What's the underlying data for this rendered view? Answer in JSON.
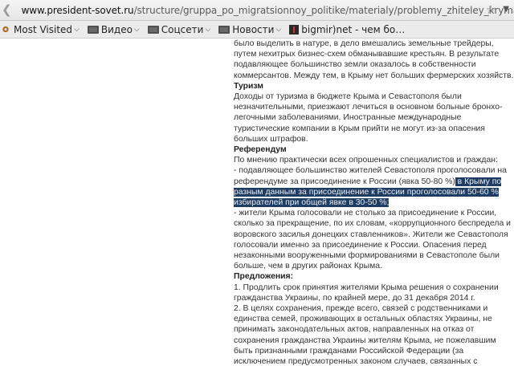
{
  "browser": {
    "url_domain": "www.president-sovet.ru",
    "url_path": "/structure/gruppa_po_migratsionnoy_politike/materialy/problemy_zhiteley_kryma.php",
    "bookmarks": [
      {
        "label": "Most Visited",
        "icon": "gear-icon"
      },
      {
        "label": "Видео",
        "icon": "folder-icon"
      },
      {
        "label": "Соцсети",
        "icon": "folder-icon"
      },
      {
        "label": "Новости",
        "icon": "folder-icon"
      },
      {
        "label": "bigmir)net - чем бо…",
        "icon": "site-icon"
      }
    ]
  },
  "article": {
    "p_land": "было выделить в натуре, в дело вмешались земельные трейдеры, путем нехитрых бизнес-схем обманывавшие крестьян. В результате подавляющее большинство земли оказалось в собственности коммерсантов. Между тем, в Крыму нет больших фермерских хозяйств.",
    "h_tourism": "Туризм",
    "p_tourism": "Доходы от туризма в бюджете Крыма и Севастополя были незначительными, приезжают лечиться в основном больные бронхо-легочными заболеваниями. Иностранные международные туристические компании в Крым прийти не могут из-за опасения больших штрафов.",
    "h_referendum": "Референдум",
    "p_ref_intro": "По мнению практически всех опрошенных специалистов и граждан:",
    "p_ref_1a": "- подавляющее большинство жителей Севастополя проголосовали на референдуме за присоединение к России (явка 50-80 %)",
    "p_ref_1_hl": " в Крыму по разным данным за присоединение к России проголосовали 50-60 % избирателей при общей явке в 30-50 %;",
    "p_ref_2": "- жители Крыма голосовали не столько за присоединение к России, сколько за прекращение, по их словам, «коррупционного беспредела и воровского засилья донецких ставленников». Жители же Севастополя голосовали именно за присоединение к России. Опасения перед незаконными вооруженными формированиями в Севастополе были больше, чем в других районах Крыма.",
    "h_proposals": "Предложения:",
    "p_prop_1": "1. Продлить срок принятия жителями Крыма решения о сохранении гражданства Украины, по крайней мере, до 31 декабря 2014 г.",
    "p_prop_2": "2. В целях сохранения, прежде всего, связей с родственниками и единства семей, проживающих в остальных областях Украины, не принимать законодательных актов, направленных на отказ от сохранения гражданства Украины жителям Крыма, не пожелавшим быть признанными гражданами Российской Федерации (за исключением предусмотренных законом случаев, связанных с государственной, муниципальной или военной службой)."
  }
}
